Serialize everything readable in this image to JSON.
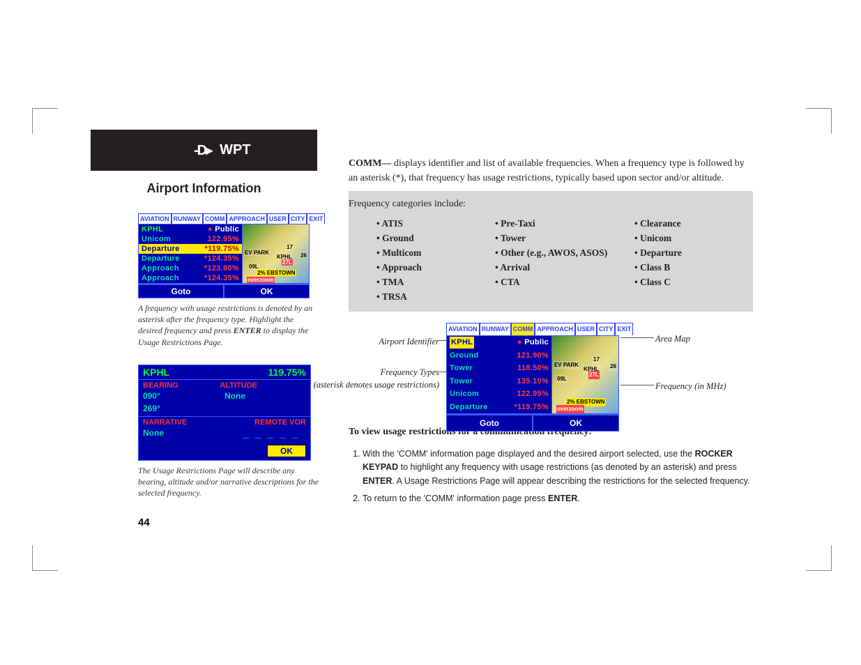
{
  "header": {
    "icon_label": "D",
    "tab_label": "WPT"
  },
  "section_title": "Airport Information",
  "gps1": {
    "tabs": [
      "AVIATION",
      "RUNWAY",
      "COMM",
      "APPROACH",
      "USER",
      "CITY",
      "EXIT"
    ],
    "active_tab": "COMM",
    "identifier": "KPHL",
    "airport_class": "Public",
    "rows": [
      {
        "type": "Unicom",
        "freq": "122.95%",
        "highlight": false,
        "restricted": false
      },
      {
        "type": "Departure",
        "freq": "*119.75%",
        "highlight": true,
        "restricted": true
      },
      {
        "type": "Departure",
        "freq": "*124.35%",
        "highlight": false,
        "restricted": true
      },
      {
        "type": "Approach",
        "freq": "*123.80%",
        "highlight": false,
        "restricted": true
      },
      {
        "type": "Approach",
        "freq": "*124.35%",
        "highlight": false,
        "restricted": true
      }
    ],
    "map_labels": [
      "EV PARK",
      "KPHL",
      "17",
      "26",
      "09L",
      "27L",
      "2% EBSTOWN",
      "overzoom"
    ],
    "footer": {
      "goto": "Goto",
      "ok": "OK"
    }
  },
  "caption1": {
    "text_a": "A frequency with usage restrictions is denoted by an asterisk after the frequency type. Highlight the desired frequency and press ",
    "bold": "ENTER",
    "text_b": " to display the Usage Restrictions Page."
  },
  "restrict": {
    "ident": "KPHL",
    "freq": "119.75%",
    "headings": {
      "bearing": "BEARING",
      "altitude": "ALTITUDE",
      "narrative": "NARRATIVE",
      "remote_vor": "REMOTE VOR"
    },
    "values": {
      "bearing1": "090°",
      "bearing2": "269°",
      "altitude": "None",
      "narrative": "None",
      "dashes": "_ _ _ _ _"
    },
    "ok": "OK"
  },
  "caption2": "The Usage Restrictions Page will describe any bearing, altitude and/or narrative descriptions for the selected frequency.",
  "main": {
    "comm_lead_bold": "COMM—",
    "comm_lead_rest": " displays identifier and list of available frequencies. When a frequency type is followed by an asterisk (*), that frequency has usage restrictions, typically based upon sector and/or altitude.",
    "cat_intro": "Frequency categories include:",
    "cats_col1": [
      "ATIS",
      "Ground",
      "Multicom",
      "Approach",
      "TMA",
      "TRSA"
    ],
    "cats_col2": [
      "Pre-Taxi",
      "Tower",
      "Other (e.g., AWOS, ASOS)",
      "Arrival",
      "CTA"
    ],
    "cats_col3": [
      "Clearance",
      "Unicom",
      "Departure",
      "Class B",
      "Class C"
    ]
  },
  "gps2": {
    "tabs": [
      "AVIATION",
      "RUNWAY",
      "COMM",
      "APPROACH",
      "USER",
      "CITY",
      "EXIT"
    ],
    "active_tab": "COMM",
    "identifier": "KPHL",
    "airport_class": "Public",
    "rows": [
      {
        "type": "Ground",
        "freq": "121.90%",
        "restricted": false
      },
      {
        "type": "Tower",
        "freq": "118.50%",
        "restricted": false
      },
      {
        "type": "Tower",
        "freq": "135.10%",
        "restricted": false
      },
      {
        "type": "Unicom",
        "freq": "122.95%",
        "restricted": false
      },
      {
        "type": "Departure",
        "freq": "*119.75%",
        "restricted": true
      }
    ],
    "map_labels": [
      "EV PARK",
      "KPHL",
      "17",
      "26",
      "09L",
      "27L",
      "2% EBSTOWN",
      "overzoom"
    ],
    "footer": {
      "goto": "Goto",
      "ok": "OK"
    }
  },
  "annotations": {
    "airport_identifier": "Airport Identifier",
    "frequency_types": "Frequency Types",
    "freq_paren": "(asterisk denotes usage restrictions)",
    "area_map": "Area Map",
    "frequency_mhz": "Frequency (in MHz)"
  },
  "procedure": {
    "title": "To view usage restrictions for a communication frequency:",
    "step1_a": "With the 'COMM' information page displayed and the desired airport selected, use the ",
    "step1_b": "ROCKER KEYPAD",
    "step1_c": " to highlight any frequency with usage restrictions (as denoted by an asterisk) and press ",
    "step1_d": "ENTER",
    "step1_e": ". A Usage Restrictions Page will appear describing the restrictions for the selected frequency.",
    "step2_a": "To return to the 'COMM' information page press ",
    "step2_b": "ENTER",
    "step2_c": "."
  },
  "page_number": "44"
}
